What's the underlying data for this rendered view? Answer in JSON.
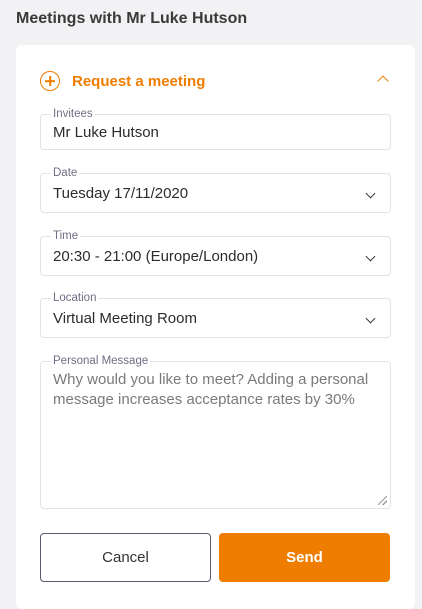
{
  "page": {
    "title": "Meetings with Mr Luke Hutson"
  },
  "panel": {
    "title": "Request a meeting"
  },
  "fields": {
    "invitees": {
      "label": "Invitees",
      "value": "Mr Luke Hutson"
    },
    "date": {
      "label": "Date",
      "value": "Tuesday 17/11/2020"
    },
    "time": {
      "label": "Time",
      "value": "20:30 - 21:00 (Europe/London)"
    },
    "location": {
      "label": "Location",
      "value": "Virtual Meeting Room"
    },
    "message": {
      "label": "Personal Message",
      "placeholder": "Why would you like to meet? Adding a personal message increases acceptance rates by 30%"
    }
  },
  "actions": {
    "cancel_label": "Cancel",
    "send_label": "Send"
  },
  "colors": {
    "accent": "#ef7d00",
    "background": "#f2f2f4",
    "card": "#ffffff"
  },
  "icons": {
    "panel_toggle": "plus-circle-icon",
    "collapse": "chevron-up-icon",
    "select": "chevron-down-icon"
  }
}
